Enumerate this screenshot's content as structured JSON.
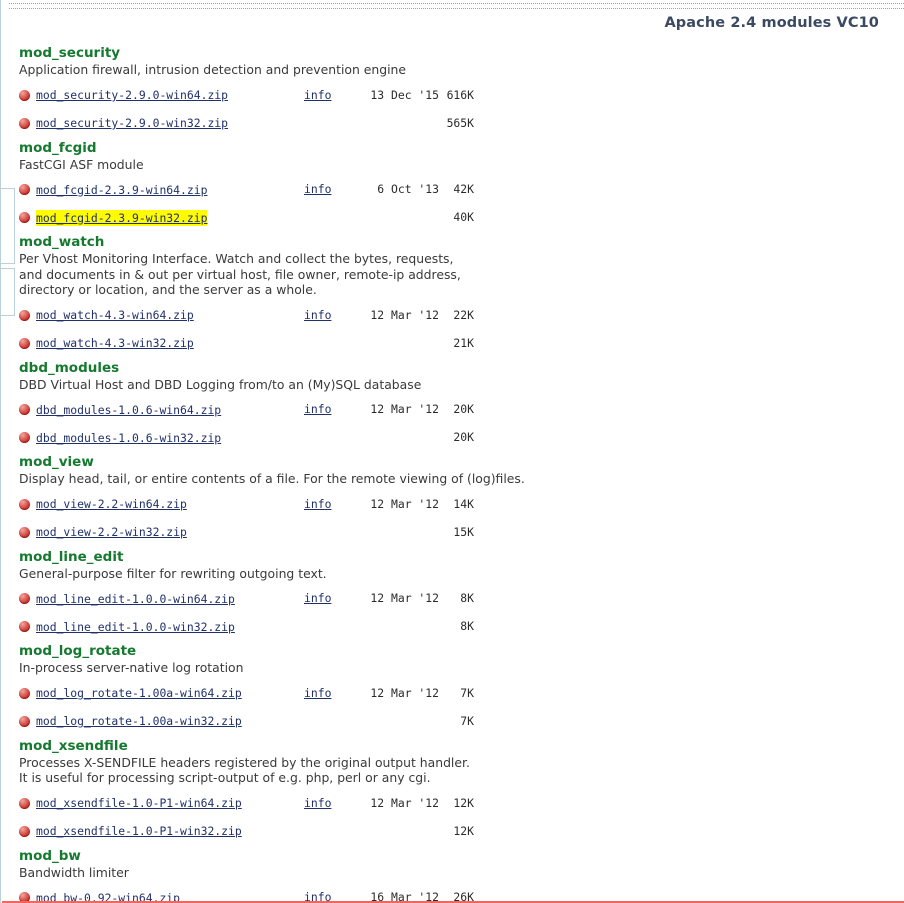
{
  "header": {
    "title": "Apache 2.4 modules VC10",
    "accent_color": "#3b4a63"
  },
  "colors": {
    "module_heading": "#15792f",
    "link": "#20306b",
    "highlight": "#fffb00",
    "bullet": "#c62b24",
    "bottom_rule": "#f2665c",
    "frame_border": "#bcd2da"
  },
  "labels": {
    "info": "info"
  },
  "modules": [
    {
      "name": "mod_security",
      "description": "Application firewall, intrusion detection and prevention engine",
      "files": [
        {
          "filename": "mod_security-2.9.0-win64.zip",
          "info": "info",
          "date": "13 Dec '15",
          "size": "616K",
          "highlighted": false
        },
        {
          "filename": "mod_security-2.9.0-win32.zip",
          "info": "",
          "date": "",
          "size": "565K",
          "highlighted": false
        }
      ]
    },
    {
      "name": "mod_fcgid",
      "description": "FastCGI ASF module",
      "files": [
        {
          "filename": "mod_fcgid-2.3.9-win64.zip",
          "info": "info",
          "date": "6 Oct '13",
          "size": "42K",
          "highlighted": false
        },
        {
          "filename": "mod_fcgid-2.3.9-win32.zip",
          "info": "",
          "date": "",
          "size": "40K",
          "highlighted": true
        }
      ]
    },
    {
      "name": "mod_watch",
      "description": "Per Vhost Monitoring Interface. Watch and collect the bytes, requests,\nand documents in & out per virtual host, file owner, remote-ip address,\ndirectory or location, and the server as a whole.",
      "files": [
        {
          "filename": "mod_watch-4.3-win64.zip",
          "info": "info",
          "date": "12 Mar '12",
          "size": "22K",
          "highlighted": false
        },
        {
          "filename": "mod_watch-4.3-win32.zip",
          "info": "",
          "date": "",
          "size": "21K",
          "highlighted": false
        }
      ]
    },
    {
      "name": "dbd_modules",
      "description": "DBD Virtual Host and DBD Logging from/to an (My)SQL database",
      "files": [
        {
          "filename": "dbd_modules-1.0.6-win64.zip",
          "info": "info",
          "date": "12 Mar '12",
          "size": "20K",
          "highlighted": false
        },
        {
          "filename": "dbd_modules-1.0.6-win32.zip",
          "info": "",
          "date": "",
          "size": "20K",
          "highlighted": false
        }
      ]
    },
    {
      "name": "mod_view",
      "description": "Display head, tail, or entire contents of a file. For the remote viewing of (log)files.",
      "files": [
        {
          "filename": "mod_view-2.2-win64.zip",
          "info": "info",
          "date": "12 Mar '12",
          "size": "14K",
          "highlighted": false
        },
        {
          "filename": "mod_view-2.2-win32.zip",
          "info": "",
          "date": "",
          "size": "15K",
          "highlighted": false
        }
      ]
    },
    {
      "name": "mod_line_edit",
      "description": "General-purpose filter for rewriting outgoing text.",
      "files": [
        {
          "filename": "mod_line_edit-1.0.0-win64.zip",
          "info": "info",
          "date": "12 Mar '12",
          "size": "8K",
          "highlighted": false
        },
        {
          "filename": "mod_line_edit-1.0.0-win32.zip",
          "info": "",
          "date": "",
          "size": "8K",
          "highlighted": false
        }
      ]
    },
    {
      "name": "mod_log_rotate",
      "description": "In-process server-native log rotation",
      "files": [
        {
          "filename": "mod_log_rotate-1.00a-win64.zip",
          "info": "info",
          "date": "12 Mar '12",
          "size": "7K",
          "highlighted": false
        },
        {
          "filename": "mod_log_rotate-1.00a-win32.zip",
          "info": "",
          "date": "",
          "size": "7K",
          "highlighted": false
        }
      ]
    },
    {
      "name": "mod_xsendfile",
      "description": "Processes X-SENDFILE headers registered by the original output handler.\nIt is useful for processing script-output of e.g. php, perl or any cgi.",
      "files": [
        {
          "filename": "mod_xsendfile-1.0-P1-win64.zip",
          "info": "info",
          "date": "12 Mar '12",
          "size": "12K",
          "highlighted": false
        },
        {
          "filename": "mod_xsendfile-1.0-P1-win32.zip",
          "info": "",
          "date": "",
          "size": "12K",
          "highlighted": false
        }
      ]
    },
    {
      "name": "mod_bw",
      "description": "Bandwidth limiter",
      "files": [
        {
          "filename": "mod_bw-0.92-win64.zip",
          "info": "info",
          "date": "16 Mar '12",
          "size": "26K",
          "highlighted": false
        }
      ]
    }
  ]
}
